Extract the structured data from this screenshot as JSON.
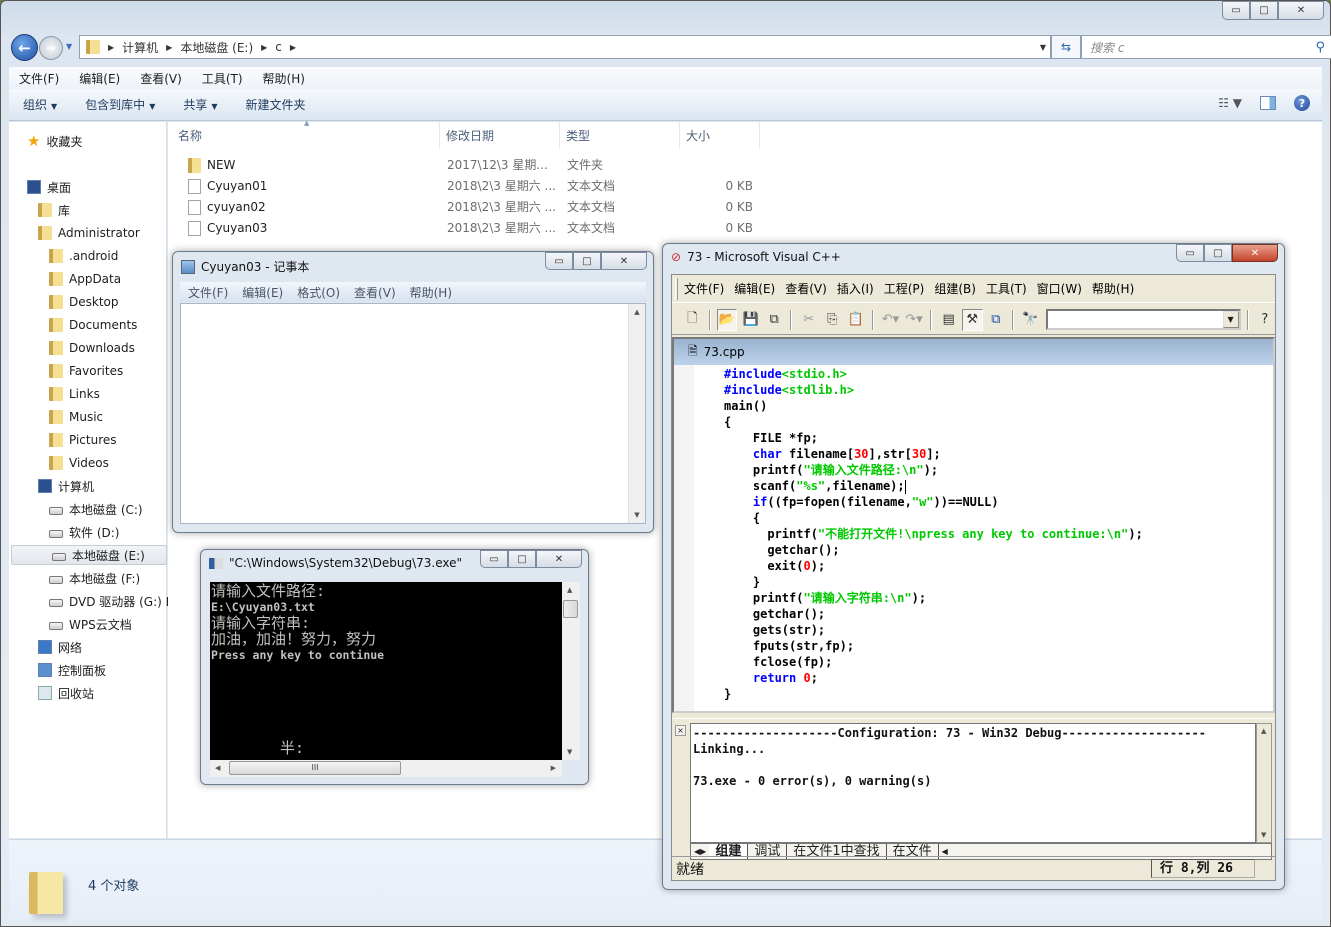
{
  "explorer": {
    "window_buttons": {
      "minimize": "▭",
      "maximize": "□",
      "close": "✕"
    },
    "breadcrumb": [
      "计算机",
      "本地磁盘 (E:)",
      "c"
    ],
    "search_placeholder": "搜索 c",
    "menu": [
      "文件(F)",
      "编辑(E)",
      "查看(V)",
      "工具(T)",
      "帮助(H)"
    ],
    "commands": [
      "组织",
      "包含到库中",
      "共享",
      "新建文件夹"
    ],
    "nav": {
      "favorites": "收藏夹",
      "desktop": "桌面",
      "library": "库",
      "user": "Administrator",
      "user_folders": [
        ".android",
        "AppData",
        "Desktop",
        "Documents",
        "Downloads",
        "Favorites",
        "Links",
        "Music",
        "Pictures",
        "Videos"
      ],
      "computer": "计算机",
      "drives": [
        "本地磁盘 (C:)",
        "软件 (D:)",
        "本地磁盘 (E:)",
        "本地磁盘 (F:)",
        "DVD 驱动器 (G:) I",
        "WPS云文档"
      ],
      "selected_drive": "本地磁盘 (E:)",
      "network": "网络",
      "control_panel": "控制面板",
      "recycle_bin": "回收站"
    },
    "columns": [
      "名称",
      "修改日期",
      "类型",
      "大小"
    ],
    "files": [
      {
        "name": "NEW",
        "date": "2017\\12\\3 星期...",
        "type": "文件夹",
        "size": "",
        "kind": "folder"
      },
      {
        "name": "Cyuyan01",
        "date": "2018\\2\\3 星期六 ...",
        "type": "文本文档",
        "size": "0 KB",
        "kind": "text"
      },
      {
        "name": "cyuyan02",
        "date": "2018\\2\\3 星期六 ...",
        "type": "文本文档",
        "size": "0 KB",
        "kind": "text"
      },
      {
        "name": "Cyuyan03",
        "date": "2018\\2\\3 星期六 ...",
        "type": "文本文档",
        "size": "0 KB",
        "kind": "text"
      }
    ],
    "status": "4 个对象"
  },
  "notepad": {
    "title": "Cyuyan03 - 记事本",
    "menu": [
      "文件(F)",
      "编辑(E)",
      "格式(O)",
      "查看(V)",
      "帮助(H)"
    ],
    "content": ""
  },
  "console": {
    "title": "\"C:\\Windows\\System32\\Debug\\73.exe\"",
    "lines": [
      "请输入文件路径:",
      "E:\\Cyuyan03.txt",
      "请输入字符串:",
      "加油，加油！努力，努力",
      "Press any key to continue"
    ],
    "ime_indicator": "半:"
  },
  "vc": {
    "title": "73 - Microsoft Visual C++",
    "menu": [
      "文件(F)",
      "编辑(E)",
      "查看(V)",
      "插入(I)",
      "工程(P)",
      "组建(B)",
      "工具(T)",
      "窗口(W)",
      "帮助(H)"
    ],
    "doc_title": "73.cpp",
    "output_lines": [
      "--------------------Configuration: 73 - Win32 Debug--------------------",
      "Linking...",
      "",
      "73.exe - 0 error(s), 0 warning(s)"
    ],
    "output_tabs": [
      "组建",
      "调试",
      "在文件1中查找",
      "在文件"
    ],
    "status": "就绪",
    "cursor_pos": "行 8,列 26"
  }
}
